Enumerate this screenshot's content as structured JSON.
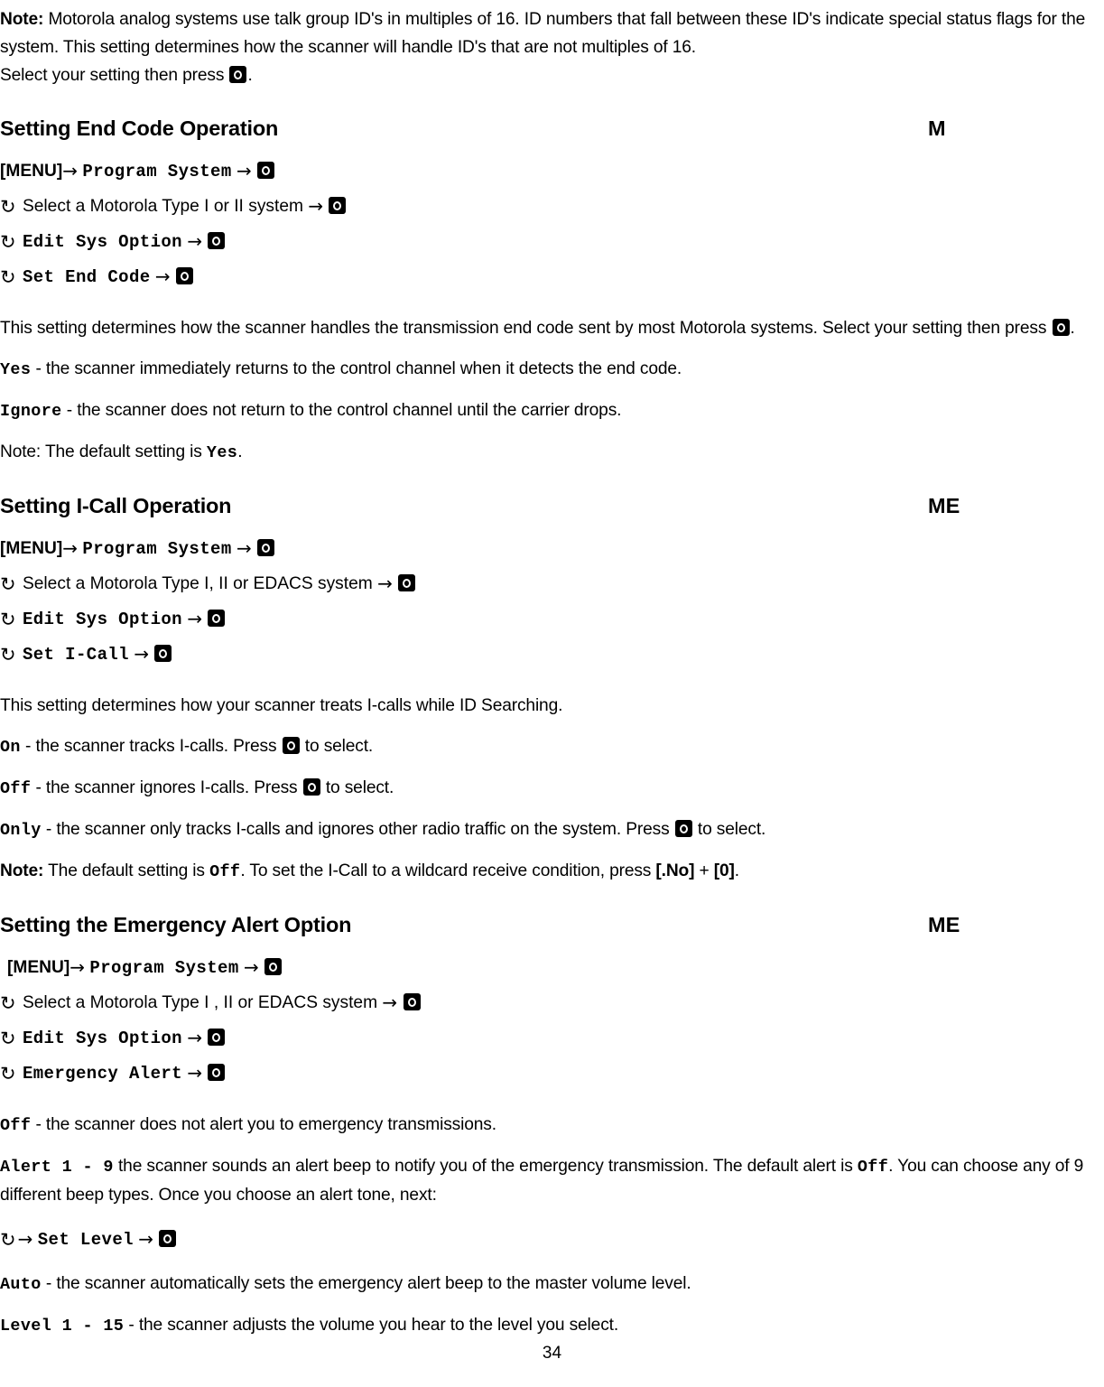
{
  "page": {
    "number": "34"
  },
  "icons": {
    "select_button": "select-button-icon",
    "arrow": "→",
    "rotate_knob": "↻"
  },
  "intro": {
    "note_label": "Note:",
    "note_text_1": " Motorola analog systems use talk group ID's in multiples of 16. ID numbers that fall between these ID's indicate special status flags for the system. This setting determines how the scanner will handle ID's that are not multiples of 16.",
    "select_line_prefix": "Select your setting then press ",
    "select_line_suffix": "."
  },
  "sections": [
    {
      "id": "end-code",
      "heading": "Setting End Code Operation",
      "marker": "M",
      "path": [
        {
          "menu_label": "[MENU]",
          "mono": "Program System",
          "has_rotate": false
        },
        {
          "plain": "Select a Motorola Type I or II system ",
          "has_rotate": true
        },
        {
          "mono": "Edit Sys Option",
          "has_rotate": true
        },
        {
          "mono": "Set End Code",
          "has_rotate": true
        }
      ],
      "body": [
        "This setting determines how the scanner handles the transmission end code sent by most Motorola systems. Select your setting then press ",
        "."
      ],
      "options": [
        {
          "term": "Yes",
          "text": " - the scanner immediately returns to the control channel when it detects the end code."
        },
        {
          "term": "Ignore",
          "text": " - the scanner does not return to the control channel until the carrier drops."
        }
      ],
      "note_prefix": "Note: The default setting is ",
      "note_term": "Yes",
      "note_suffix": "."
    },
    {
      "id": "i-call",
      "heading": "Setting I-Call Operation",
      "marker": "ME",
      "path": [
        {
          "menu_label": "[MENU]",
          "mono": "Program System",
          "has_rotate": false
        },
        {
          "plain": "Select a Motorola Type I, II or EDACS system ",
          "has_rotate": true
        },
        {
          "mono": "Edit Sys Option",
          "has_rotate": true
        },
        {
          "mono": "Set I-Call",
          "has_rotate": true
        }
      ],
      "body": "This setting determines how your scanner treats I-calls while ID Searching.",
      "options": [
        {
          "term": "On",
          "text_before": " - the scanner tracks I-calls. Press ",
          "text_after": " to select."
        },
        {
          "term": "Off",
          "text_before": " - the scanner ignores I-calls. Press ",
          "text_after": " to select."
        },
        {
          "term": "Only",
          "text_before": " - the scanner only tracks I-calls and ignores other radio traffic on the system. Press ",
          "text_after": " to select."
        }
      ],
      "note_label": "Note:",
      "note_part1": " The default setting is ",
      "note_term": "Off",
      "note_part2": ". To set the I-Call to a wildcard receive condition, press ",
      "note_key1": "[.No]",
      "note_plus": " + ",
      "note_key2": "[0]",
      "note_end": "."
    },
    {
      "id": "emergency-alert",
      "heading": "Setting the Emergency Alert Option",
      "marker": "ME",
      "path": [
        {
          "menu_label": "[MENU]",
          "mono": "Program System",
          "has_rotate": false,
          "indent": true
        },
        {
          "plain": "Select a Motorola Type I , II or EDACS system ",
          "has_rotate": true
        },
        {
          "mono": "Edit Sys Option",
          "has_rotate": true
        },
        {
          "mono": "Emergency Alert",
          "has_rotate": true
        }
      ],
      "options": [
        {
          "term": "Off",
          "text": " - the scanner does not alert you to emergency transmissions."
        }
      ],
      "alert_term": "Alert 1 - 9",
      "alert_text_1": " the scanner sounds an alert beep to notify you of the emergency transmission. The default alert is ",
      "alert_term_2": "Off",
      "alert_text_2": ". You can choose any of 9 different beep types. Once you choose an alert tone, next:",
      "set_level_mono": "Set Level",
      "level_options": [
        {
          "term": "Auto",
          "text": " - the scanner automatically sets the emergency alert beep to the master volume level."
        },
        {
          "term": "Level 1 - 15",
          "text": " - the scanner adjusts the volume you hear to the level you select."
        }
      ]
    }
  ]
}
